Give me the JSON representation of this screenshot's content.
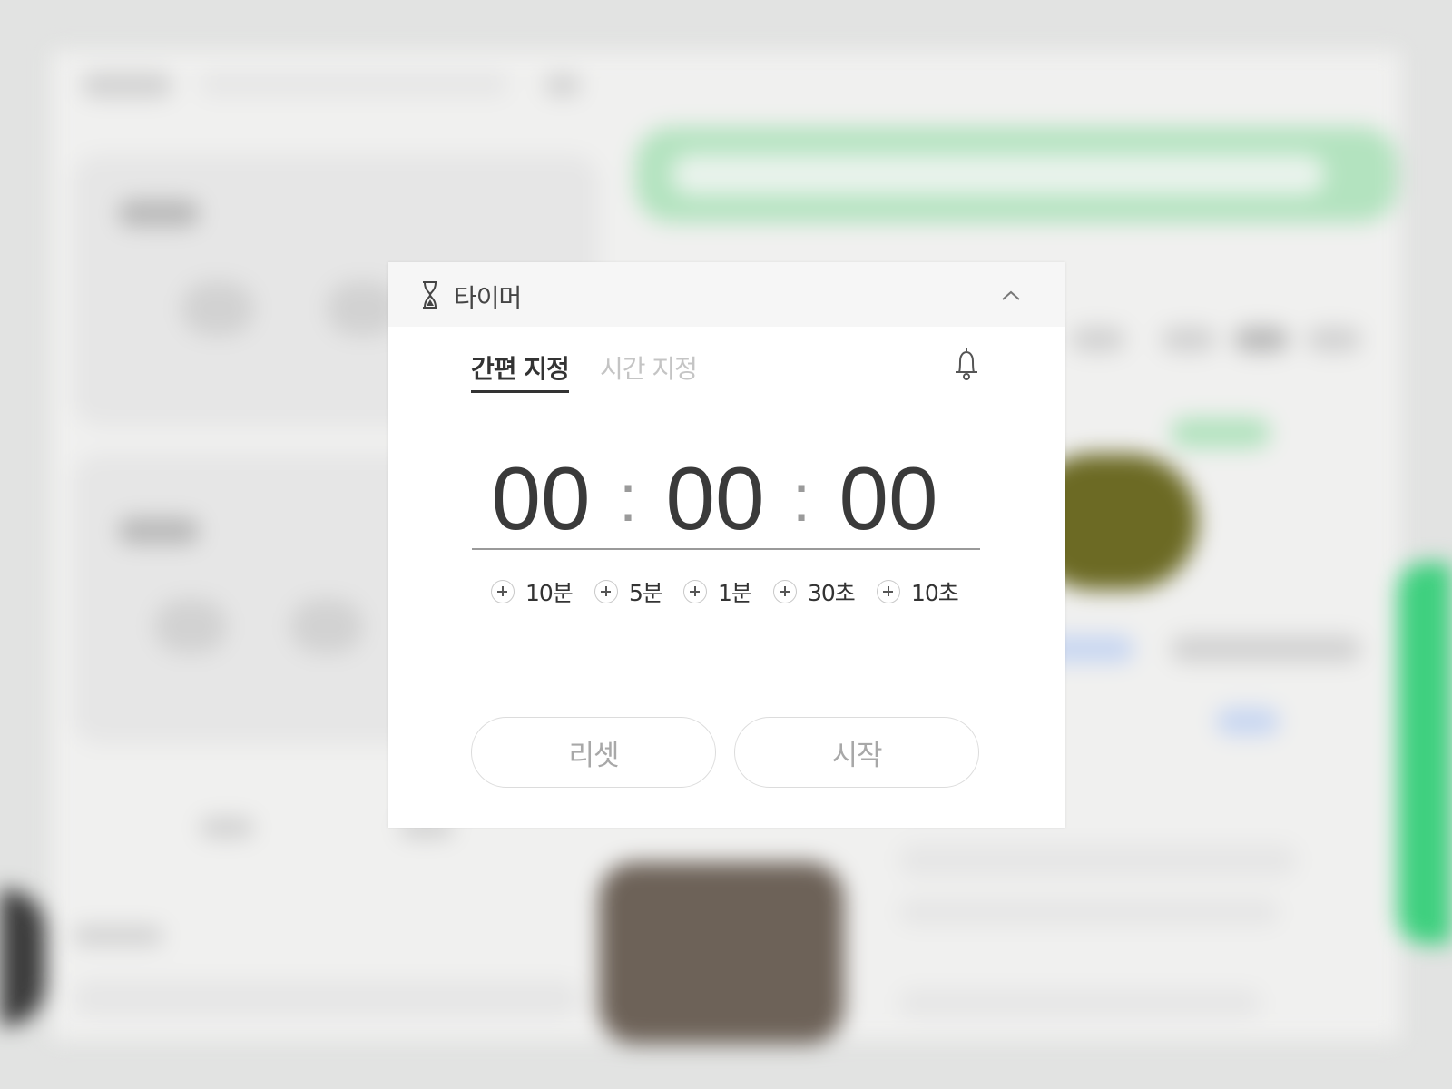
{
  "timer": {
    "title": "타이머",
    "header_icon": "hourglass-icon",
    "collapse_icon": "chevron-up-icon",
    "alarm_icon": "bell-icon",
    "tabs": [
      {
        "label": "간편 지정",
        "active": true
      },
      {
        "label": "시간 지정",
        "active": false
      }
    ],
    "display": {
      "hours": "00",
      "minutes": "00",
      "seconds": "00",
      "separator": ":"
    },
    "quick_add": [
      {
        "label": "10분"
      },
      {
        "label": "5분"
      },
      {
        "label": "1분"
      },
      {
        "label": "30초"
      },
      {
        "label": "10초"
      }
    ],
    "buttons": {
      "reset": "리셋",
      "start": "시작"
    }
  },
  "colors": {
    "header_bg": "#f6f6f6",
    "digit": "#3a3a3a",
    "active_tab": "#333333",
    "inactive_tab": "#c4c4c4",
    "button_text": "#a8a8a8",
    "backdrop_accent": "#3fd07f"
  }
}
